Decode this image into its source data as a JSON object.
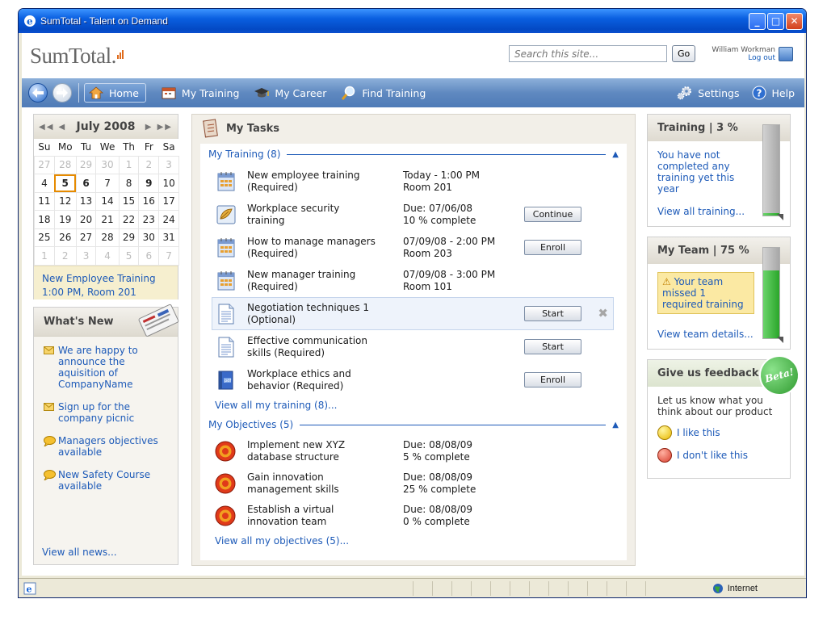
{
  "window": {
    "title": "SumTotal - Talent on Demand"
  },
  "header": {
    "logo_text": "SumTotal.",
    "search_placeholder": "Search this site...",
    "go_label": "Go",
    "user_name": "William Workman",
    "logout_label": "Log out"
  },
  "nav": {
    "home": "Home",
    "my_training": "My Training",
    "my_career": "My Career",
    "find_training": "Find Training",
    "settings": "Settings",
    "help": "Help"
  },
  "calendar": {
    "month": "July 2008",
    "weekdays": [
      "Su",
      "Mo",
      "Tu",
      "We",
      "Th",
      "Fr",
      "Sa"
    ],
    "weeks": [
      [
        "27",
        "28",
        "29",
        "30",
        "1",
        "2",
        "3"
      ],
      [
        "4",
        "5",
        "6",
        "7",
        "8",
        "9",
        "10"
      ],
      [
        "11",
        "12",
        "13",
        "14",
        "15",
        "16",
        "17"
      ],
      [
        "18",
        "19",
        "20",
        "21",
        "22",
        "23",
        "24"
      ],
      [
        "25",
        "26",
        "27",
        "28",
        "29",
        "30",
        "31"
      ],
      [
        "1",
        "2",
        "3",
        "4",
        "5",
        "6",
        "7"
      ]
    ],
    "event_line1": "New Employee Training",
    "event_line2": "1:00 PM, Room 201"
  },
  "whats_new": {
    "title": "What's New",
    "items": [
      {
        "icon": "envelope-icon",
        "text": "We are happy to announce the aquisition of CompanyName"
      },
      {
        "icon": "envelope-icon",
        "text": "Sign up for the company picnic"
      },
      {
        "icon": "speech-bubble-icon",
        "text": "Managers objectives available"
      },
      {
        "icon": "speech-bubble-icon",
        "text": "New Safety Course available"
      }
    ],
    "footer": "View all news..."
  },
  "tasks": {
    "title": "My Tasks",
    "training_header": "My Training (8)",
    "training": [
      {
        "icon": "calendar-icon",
        "name1": "New employee training",
        "name2": "(Required)",
        "due1": "Today - 1:00 PM",
        "due2": "Room 201",
        "button": ""
      },
      {
        "icon": "elearning-icon",
        "name1": "Workplace security",
        "name2": "training",
        "due1": "Due: 07/06/08",
        "due2": "10 % complete",
        "button": "Continue"
      },
      {
        "icon": "calendar-icon",
        "name1": "How to manage managers",
        "name2": "(Required)",
        "due1": "07/09/08 - 2:00 PM",
        "due2": "Room 203",
        "button": "Enroll"
      },
      {
        "icon": "calendar-icon",
        "name1": "New manager training",
        "name2": "(Required)",
        "due1": "07/09/08 - 3:00 PM",
        "due2": "Room 101",
        "button": ""
      },
      {
        "icon": "document-icon",
        "name1": "Negotiation techniques 1",
        "name2": "(Optional)",
        "due1": "",
        "due2": "",
        "button": "Start"
      },
      {
        "icon": "document-icon",
        "name1": "Effective communication",
        "name2": "skills (Required)",
        "due1": "",
        "due2": "",
        "button": "Start"
      },
      {
        "icon": "book-icon",
        "name1": "Workplace ethics and",
        "name2": "behavior (Required)",
        "due1": "",
        "due2": "",
        "button": "Enroll"
      }
    ],
    "view_all_training": "View all my training (8)...",
    "objectives_header": "My Objectives (5)",
    "objectives": [
      {
        "name1": "Implement new XYZ",
        "name2": "database structure",
        "due1": "Due: 08/08/09",
        "due2": "5 % complete"
      },
      {
        "name1": "Gain innovation",
        "name2": "management skills",
        "due1": "Due: 08/08/09",
        "due2": "25 % complete"
      },
      {
        "name1": "Establish a virtual",
        "name2": "innovation team",
        "due1": "Due: 08/08/09",
        "due2": "0 % complete"
      }
    ],
    "view_all_objectives": "View all my objectives (5)..."
  },
  "training_box": {
    "title": "Training | 3 %",
    "level": 0.03,
    "message": "You have not completed any training yet this year",
    "link": "View all training..."
  },
  "team_box": {
    "title": "My Team | 75 %",
    "level": 0.75,
    "alert": "Your team missed 1 required training",
    "link": "View team details..."
  },
  "feedback": {
    "title": "Give us feedback",
    "badge": "Beta!",
    "text": "Let us know what you think about our product",
    "like": "I like this",
    "dislike": "I don't like this"
  },
  "status": {
    "zone": "Internet"
  },
  "colors": {
    "link": "#1d5ab8",
    "nav": "#5f89c0",
    "alert": "#fbe9a3",
    "gauge_fill": "#2aa62a"
  }
}
